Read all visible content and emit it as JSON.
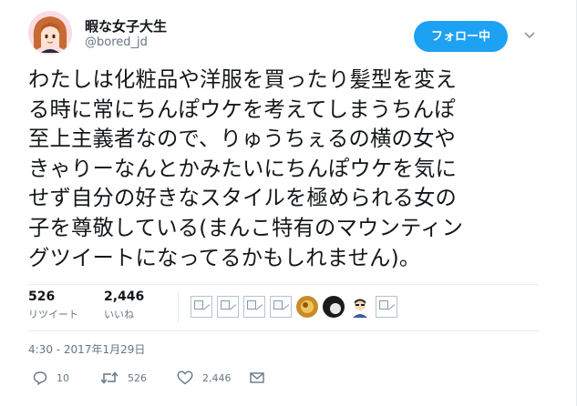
{
  "user": {
    "name": "暇な女子大生",
    "handle": "@bored_jd"
  },
  "follow_button": {
    "label": "フォロー中"
  },
  "tweet": {
    "lines": [
      "わたしは化粧品や洋服を買ったり髪型を変え",
      "る時に常にちんぽウケを考えてしまうちんぽ",
      "至上主義者なので、りゅうちぇるの横の女や",
      "きゃりーなんとかみたいにちんぽウケを気に",
      "せず自分の好きなスタイルを極められる女の",
      "子を尊敬している(まんこ特有のマウンティン",
      "グツイートになってるかもしれません)。"
    ]
  },
  "stats": {
    "retweets": {
      "count": "526",
      "label": "リツイート"
    },
    "likes": {
      "count": "2,446",
      "label": "いいね"
    }
  },
  "timestamp": "4:30 - 2017年1月29日",
  "actions": {
    "reply_count": "10",
    "retweet_count": "526",
    "like_count": "2,446"
  },
  "colors": {
    "accent": "#1da1f2",
    "text": "#14171a",
    "muted": "#657786",
    "divider": "#e6ecf0"
  }
}
